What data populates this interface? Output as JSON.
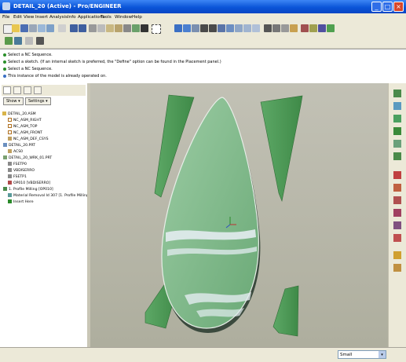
{
  "window": {
    "title": "DETAIL_20 (Active) - Pro/ENGINEER"
  },
  "menu": [
    "File",
    "Edit",
    "View",
    "Insert",
    "Analysis",
    "Info",
    "Applications",
    "Tools",
    "Window",
    "Help"
  ],
  "messages": [
    "Select a NC Sequence.",
    "Select a sketch. (If an internal sketch is preferred, the \"Define\" option can be found in the Placement panel.)",
    "Select a NC Sequence.",
    "This instance of the model is already operated on."
  ],
  "panel": {
    "show_label": "Show ▾",
    "settings_label": "Settings ▾"
  },
  "tree": [
    "DETAIL_20.ASM",
    "NC_ASM_RIGHT",
    "NC_ASM_TOP",
    "NC_ASM_FRONT",
    "NC_ASM_DEF_CSYS",
    "DETAIL_20.PRT",
    "ACS0",
    "DETAIL_20_WRK_01.PRT",
    "FSETP0",
    "VBDISERRO",
    "FSETP1",
    "OP010 [VBDISERRO]",
    "1. Profile Milling [OP010]",
    "Material Removal Id 307 [1. Profile Milling]",
    "Insert Here"
  ],
  "status": {
    "filter_value": "Small"
  },
  "colors": {
    "model_green": "#4f9a55",
    "model_face": "#8fc49a",
    "highlight_white": "#e3ecf0",
    "viewport_bg": "#b8b7aa"
  }
}
